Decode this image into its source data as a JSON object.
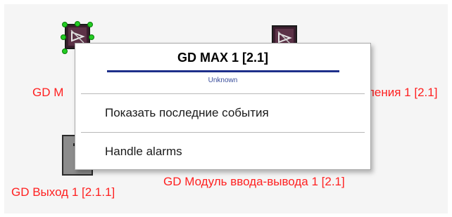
{
  "devices": [
    {
      "label": "GD M",
      "icon": "device-module-icon"
    },
    {
      "label": "ления 1 [2.1]",
      "icon": "device-module-icon"
    },
    {
      "label": "GD Выход 1 [2.1.1]",
      "icon": "output-device-icon"
    },
    {
      "label": "GD Модуль ввода-вывода 1 [2.1]"
    }
  ],
  "context_menu": {
    "title": "GD MAX 1 [2.1]",
    "status": "Unknown",
    "items": [
      {
        "label": "Показать последние события"
      },
      {
        "label": "Handle alarms"
      }
    ]
  },
  "colors": {
    "label_red": "#ff2020",
    "title_bar": "#1e2f8a",
    "selection_handle": "#22cc22"
  }
}
